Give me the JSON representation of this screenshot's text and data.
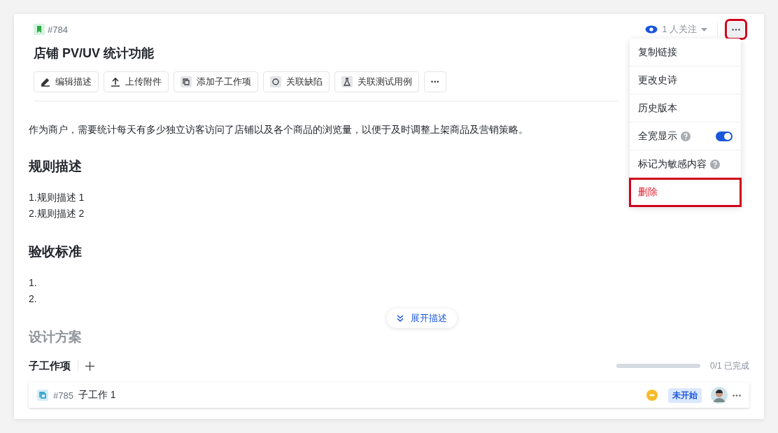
{
  "issue": {
    "id": "#784",
    "title": "店铺 PV/UV 统计功能",
    "watchers": "1 人关注",
    "more_highlighted": true
  },
  "actions": [
    {
      "label": "编辑描述",
      "kind": "edit"
    },
    {
      "label": "上传附件",
      "kind": "upload"
    },
    {
      "label": "添加子工作项",
      "kind": "subitem"
    },
    {
      "label": "关联缺陷",
      "kind": "bug"
    },
    {
      "label": "关联测试用例",
      "kind": "test"
    },
    {
      "label": "•••",
      "kind": "more"
    }
  ],
  "menu": [
    {
      "label": "复制链接",
      "kind": "plain",
      "highlighted": false
    },
    {
      "label": "更改史诗",
      "kind": "plain",
      "highlighted": false
    },
    {
      "label": "历史版本",
      "kind": "plain",
      "highlighted": false
    },
    {
      "label": "全宽显示",
      "kind": "toggle",
      "on": true,
      "highlighted": false
    },
    {
      "label": "标记为敏感内容",
      "kind": "help",
      "highlighted": false
    },
    {
      "label": "删除",
      "kind": "danger",
      "highlighted": true
    }
  ],
  "description": {
    "intro": "作为商户，需要统计每天有多少独立访客访问了店铺以及各个商品的浏览量，以便于及时调整上架商品及营销策略。",
    "sections": [
      {
        "heading": "规则描述",
        "lines": [
          "1.规则描述 1",
          "2.规则描述 2"
        ]
      },
      {
        "heading": "验收标准",
        "lines": [
          "1.",
          "2."
        ]
      }
    ],
    "faded_heading": "设计方案",
    "expand": "展开描述"
  },
  "subitems": {
    "title": "子工作项",
    "progress": "0/1 已完成",
    "level": 0,
    "rows": [
      {
        "id": "#785",
        "title": "子工作 1",
        "status": "未开始"
      }
    ]
  }
}
